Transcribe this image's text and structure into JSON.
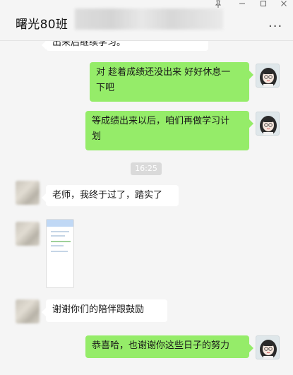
{
  "window": {
    "title": "曙光80班",
    "controls": {
      "pin": "pin-icon",
      "minimize": "minimize-icon",
      "maximize": "maximize-icon",
      "close": "close-icon"
    },
    "more_label": "···"
  },
  "messages": [
    {
      "side": "left",
      "text": "出来后继续学习。"
    },
    {
      "side": "right",
      "text_lines": [
        "对 趁着成绩还没出来 好好休息一",
        "下吧"
      ]
    },
    {
      "side": "right",
      "text_lines": [
        "等成绩出来以后，咱们再做学习计",
        "划"
      ]
    },
    {
      "type": "time",
      "text": "16:25"
    },
    {
      "side": "left",
      "text": "老师，我终于过了，踏实了"
    },
    {
      "side": "left",
      "type": "image"
    },
    {
      "side": "left",
      "text": "谢谢你们的陪伴跟鼓励"
    },
    {
      "side": "right",
      "text": "恭喜哈，也谢谢你这些日子的努力"
    }
  ],
  "colors": {
    "bubble_self": "#95ec69",
    "bubble_other": "#ffffff",
    "background": "#f5f5f5"
  }
}
